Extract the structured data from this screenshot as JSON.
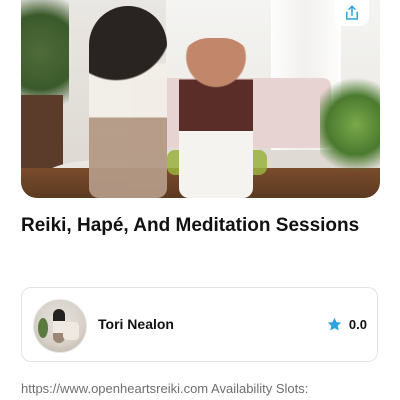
{
  "listing": {
    "title": "Reiki, Hapé, And Meditation Sessions",
    "description": "https://www.openheartsreiki.com Availability Slots:"
  },
  "host": {
    "name": "Tori Nealon",
    "rating": "0.0",
    "rating_icon": "star-icon"
  },
  "actions": {
    "share_icon": "share-icon"
  },
  "colors": {
    "accent": "#2ea3dc",
    "text": "#111111",
    "muted": "#6f6f6f",
    "border": "#e3e3e3"
  }
}
